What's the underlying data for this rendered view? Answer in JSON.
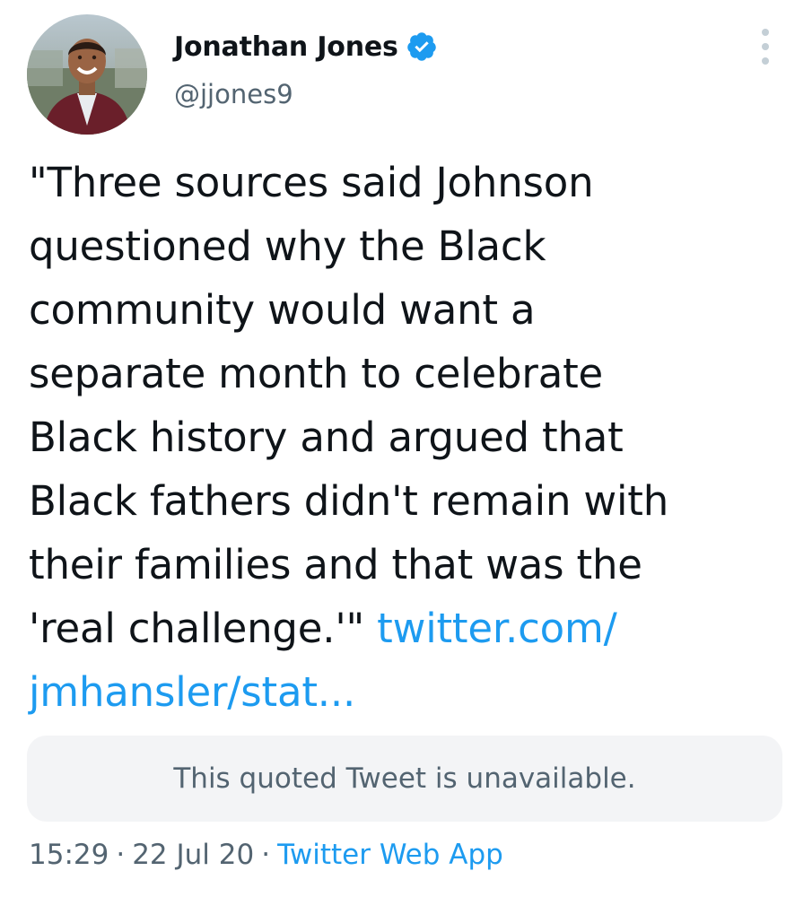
{
  "author": {
    "display_name": "Jonathan Jones",
    "handle": "@jjones9",
    "verified": true
  },
  "tweet": {
    "lines": [
      "\"Three sources said Johnson",
      "questioned why the Black",
      "community would want a",
      "separate month to celebrate",
      "Black history and argued that",
      "Black fathers didn't remain with",
      "their families and that was the"
    ],
    "last_line_text": "'real challenge.'\" ",
    "link_part1": "twitter.com/",
    "link_part2": "jmhansler/stat..."
  },
  "quoted_tweet": {
    "message": "This quoted Tweet is unavailable."
  },
  "meta": {
    "time": "15:29",
    "separator": "·",
    "date": "22 Jul 20",
    "source": "Twitter Web App"
  },
  "icons": {
    "verified": "verified-badge-icon",
    "more": "more-options-icon"
  },
  "colors": {
    "link": "#1d9bf0",
    "secondary_text": "#536471",
    "primary_text": "#0f1419",
    "quote_bg": "#f3f4f6"
  }
}
